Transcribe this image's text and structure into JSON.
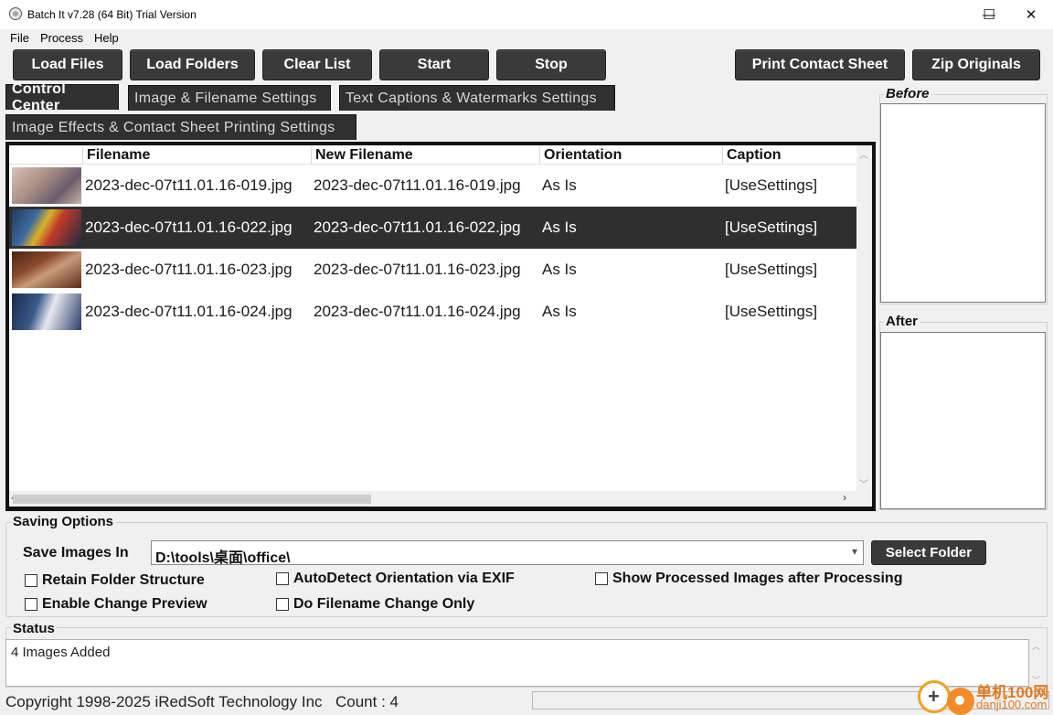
{
  "window": {
    "title": "Batch It v7.28 (64 Bit) Trial Version",
    "minimize": "—",
    "maximize": "☐",
    "close": "✕"
  },
  "menu": [
    "File",
    "Process",
    "Help"
  ],
  "toolbar": {
    "load_files": "Load Files",
    "load_folders": "Load Folders",
    "clear_list": "Clear List",
    "start": "Start",
    "stop": "Stop",
    "print_contact_sheet": "Print Contact Sheet",
    "zip_originals": "Zip Originals"
  },
  "tabs": [
    "Control Center",
    "Image & Filename Settings",
    "Text Captions & Watermarks Settings",
    "Image Effects & Contact Sheet Printing Settings"
  ],
  "list": {
    "columns": [
      "Filename",
      "New Filename",
      "Orientation",
      "Caption"
    ],
    "rows": [
      {
        "filename": "2023-dec-07t11.01.16-019.jpg",
        "new_filename": "2023-dec-07t11.01.16-019.jpg",
        "orientation": "As Is",
        "caption": "[UseSettings]",
        "selected": false
      },
      {
        "filename": "2023-dec-07t11.01.16-022.jpg",
        "new_filename": "2023-dec-07t11.01.16-022.jpg",
        "orientation": "As Is",
        "caption": "[UseSettings]",
        "selected": true
      },
      {
        "filename": "2023-dec-07t11.01.16-023.jpg",
        "new_filename": "2023-dec-07t11.01.16-023.jpg",
        "orientation": "As Is",
        "caption": "[UseSettings]",
        "selected": false
      },
      {
        "filename": "2023-dec-07t11.01.16-024.jpg",
        "new_filename": "2023-dec-07t11.01.16-024.jpg",
        "orientation": "As Is",
        "caption": "[UseSettings]",
        "selected": false
      }
    ]
  },
  "preview": {
    "before": "Before",
    "after": "After"
  },
  "saving": {
    "title": "Saving Options",
    "save_images_in_label": "Save Images In",
    "path": "D:\\tools\\桌面\\office\\",
    "select_folder": "Select Folder",
    "options": {
      "retain_folder_structure": "Retain Folder Structure",
      "enable_change_preview": "Enable Change Preview",
      "autodetect_orientation": "AutoDetect Orientation via EXIF",
      "filename_change_only": "Do Filename Change Only",
      "show_processed": "Show Processed Images after Processing"
    }
  },
  "status": {
    "title": "Status",
    "text": "4 Images Added"
  },
  "footer": {
    "copyright": "Copyright 1998-2025 iRedSoft Technology Inc",
    "count": "Count : 4"
  },
  "watermark": {
    "text1": "单机100网",
    "text2": "danji100.com"
  },
  "colors": {
    "button_bg": "#3a3a3a",
    "selected_row": "#2f2f2f",
    "window_bg": "#f0f0f0"
  }
}
